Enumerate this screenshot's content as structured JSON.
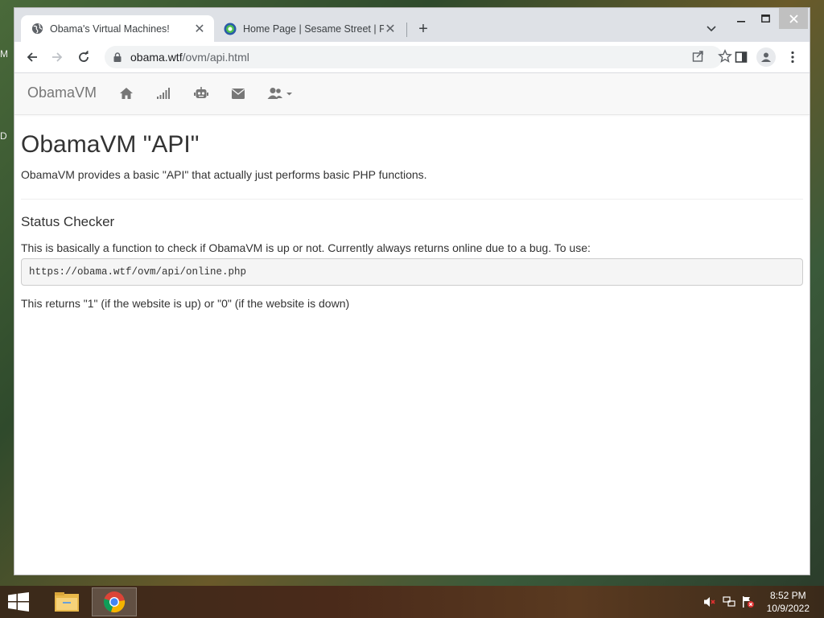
{
  "browser": {
    "tabs": [
      {
        "title": "Obama's Virtual Machines!",
        "active": true,
        "favicon": "globe-icon"
      },
      {
        "title": "Home Page | Sesame Street | PBS",
        "active": false,
        "favicon": "pbs-kids-icon"
      }
    ],
    "address": {
      "host": "obama.wtf",
      "path": "/ovm/api.html"
    }
  },
  "site": {
    "brand": "ObamaVM",
    "nav_icons": [
      "home-icon",
      "signal-icon",
      "robot-icon",
      "envelope-icon",
      "users-dropdown-icon"
    ]
  },
  "page": {
    "heading": "ObamaVM \"API\"",
    "intro": "ObamaVM provides a basic \"API\" that actually just performs basic PHP functions.",
    "section_title": "Status Checker",
    "section_desc": "This is basically a function to check if ObamaVM is up or not. Currently always returns online due to a bug. To use:",
    "code": "https://obama.wtf/ovm/api/online.php",
    "result_text": "This returns \"1\" (if the website is up) or \"0\" (if the website is down)"
  },
  "desktop": {
    "edge_labels": [
      "M",
      "D"
    ]
  },
  "taskbar": {
    "apps": [
      "file-explorer-icon",
      "chrome-icon"
    ],
    "time": "8:52 PM",
    "date": "10/9/2022"
  }
}
